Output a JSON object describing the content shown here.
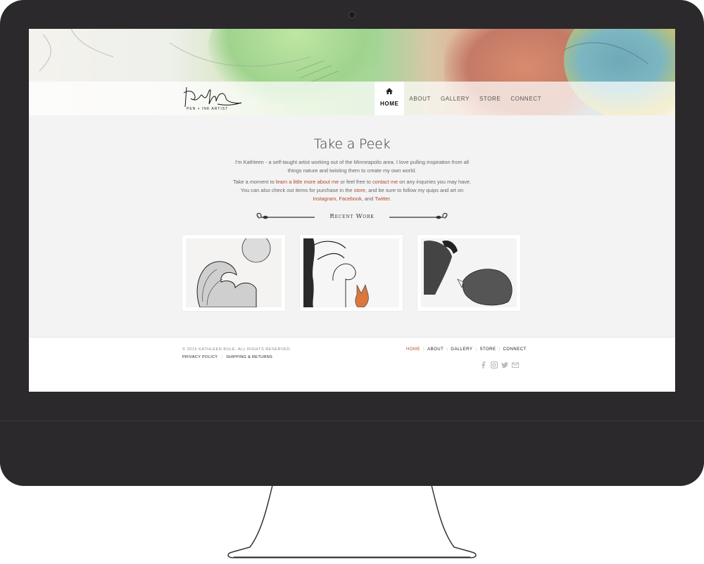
{
  "logo": {
    "signature_text": "Kathleen",
    "tagline": "PEN + INK ARTIST"
  },
  "nav": {
    "items": [
      {
        "label": "HOME",
        "icon": "home-icon",
        "active": true
      },
      {
        "label": "ABOUT",
        "active": false
      },
      {
        "label": "GALLERY",
        "active": false
      },
      {
        "label": "STORE",
        "active": false
      },
      {
        "label": "CONNECT",
        "active": false
      }
    ]
  },
  "main": {
    "title": "Take a Peek",
    "intro": "I'm Kathleen - a self-taught artist working out of the Minneapolis area. I love pulling inspiration from all things nature and twisting them to create my own world.",
    "p2": {
      "t1": "Take a moment to ",
      "link_about": "learn a little more about me",
      "t2": " or feel free to ",
      "link_contact": "contact me",
      "t3": " on any inquiries you may have. You can also check out items for purchase in the ",
      "link_store": "store",
      "t4": ", and be sure to follow my quips and art on ",
      "link_instagram": "Instagram",
      "t5": ", ",
      "link_facebook": "Facebook",
      "t6": ", and ",
      "link_twitter": "Twitter",
      "t7": "."
    },
    "recent_work_label": "Recent Work",
    "thumbnails": [
      {
        "subject": "wave-and-moon"
      },
      {
        "subject": "fox-and-tree"
      },
      {
        "subject": "falcon-and-wolf"
      }
    ]
  },
  "footer": {
    "copyright": "© 2015 KATHLEEN BULE. ALL RIGHTS RESERVED.",
    "links": [
      "PRIVACY POLICY",
      "SHIPPING & RETURNS"
    ],
    "nav": [
      "HOME",
      "ABOUT",
      "GALLERY",
      "STORE",
      "CONNECT"
    ],
    "social_icons": [
      "facebook-icon",
      "instagram-icon",
      "twitter-icon",
      "email-icon"
    ]
  },
  "colors": {
    "accent": "#b8472e",
    "bezel": "#2b292b",
    "screen_bg": "#f3f3f3"
  }
}
